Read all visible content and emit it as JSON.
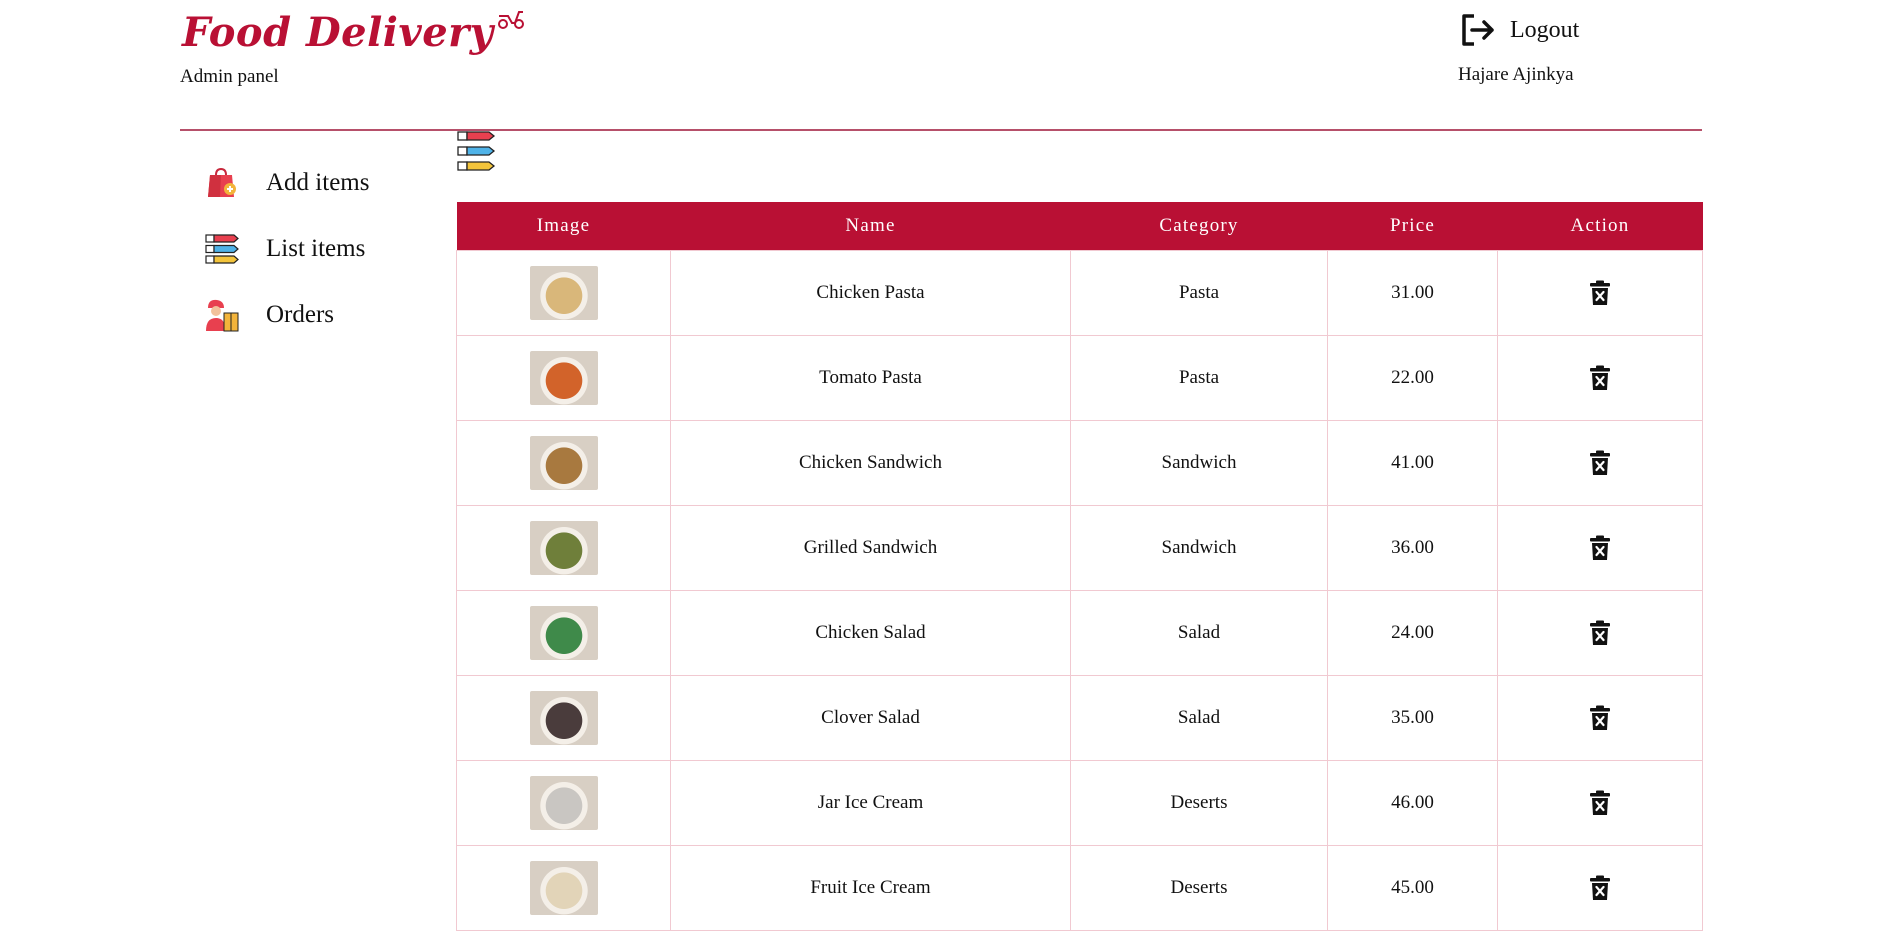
{
  "header": {
    "brand": "Food Delivery",
    "subtitle": "Admin panel",
    "logout_label": "Logout",
    "username": "Hajare Ajinkya"
  },
  "sidebar": {
    "items": [
      {
        "label": "Add items",
        "icon": "shopping-bag-add-icon"
      },
      {
        "label": "List items",
        "icon": "numbered-list-icon"
      },
      {
        "label": "Orders",
        "icon": "delivery-person-icon"
      }
    ]
  },
  "table": {
    "headers": [
      "Image",
      "Name",
      "Category",
      "Price",
      "Action"
    ],
    "rows": [
      {
        "name": "Chicken Pasta",
        "category": "Pasta",
        "price": "31.00",
        "thumb_color": "#d9b77a"
      },
      {
        "name": "Tomato Pasta",
        "category": "Pasta",
        "price": "22.00",
        "thumb_color": "#d2632a"
      },
      {
        "name": "Chicken Sandwich",
        "category": "Sandwich",
        "price": "41.00",
        "thumb_color": "#a8793f"
      },
      {
        "name": "Grilled Sandwich",
        "category": "Sandwich",
        "price": "36.00",
        "thumb_color": "#6f7f3a"
      },
      {
        "name": "Chicken Salad",
        "category": "Salad",
        "price": "24.00",
        "thumb_color": "#3f8a4a"
      },
      {
        "name": "Clover Salad",
        "category": "Salad",
        "price": "35.00",
        "thumb_color": "#4a3c3c"
      },
      {
        "name": "Jar Ice Cream",
        "category": "Deserts",
        "price": "46.00",
        "thumb_color": "#c9c6c2"
      },
      {
        "name": "Fruit Ice Cream",
        "category": "Deserts",
        "price": "45.00",
        "thumb_color": "#e2d4b8"
      }
    ]
  },
  "colors": {
    "brand": "#b91034",
    "divider": "#b6506a",
    "table_border": "#f1c9d1"
  }
}
